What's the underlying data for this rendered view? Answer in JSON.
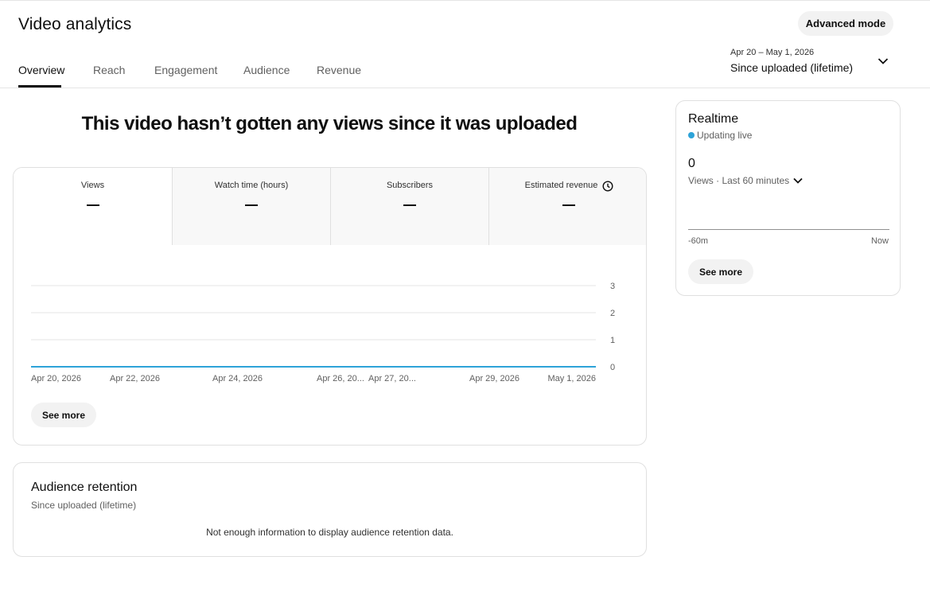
{
  "header": {
    "title": "Video analytics",
    "advanced_mode_label": "Advanced mode",
    "tabs": [
      {
        "label": "Overview",
        "active": true
      },
      {
        "label": "Reach",
        "active": false
      },
      {
        "label": "Engagement",
        "active": false
      },
      {
        "label": "Audience",
        "active": false
      },
      {
        "label": "Revenue",
        "active": false
      }
    ],
    "date_picker": {
      "range": "Apr 20 – May 1, 2026",
      "label": "Since uploaded (lifetime)",
      "icon": "chevron-down-icon"
    }
  },
  "headline": "This video hasn’t gotten any views since it was uploaded",
  "metrics": [
    {
      "label": "Views",
      "value": "—",
      "selected": true
    },
    {
      "label": "Watch time (hours)",
      "value": "—",
      "selected": false
    },
    {
      "label": "Subscribers",
      "value": "—",
      "selected": false
    },
    {
      "label": "Estimated revenue",
      "value": "—",
      "selected": false,
      "icon": "clock-icon"
    }
  ],
  "chart_data": {
    "type": "line",
    "title": "",
    "xlabel": "",
    "ylabel": "",
    "y_axis_position": "right",
    "yticks": [
      0,
      1,
      2,
      3
    ],
    "ylim": [
      0,
      3
    ],
    "grid": true,
    "x_tick_labels": [
      "Apr 20, 2026",
      "Apr 22, 2026",
      "Apr 24, 2026",
      "Apr 26, 20...",
      "Apr 27, 20...",
      "Apr 29, 2026",
      "May 1, 2026"
    ],
    "x": [
      "2026-04-20",
      "2026-04-21",
      "2026-04-22",
      "2026-04-23",
      "2026-04-24",
      "2026-04-25",
      "2026-04-26",
      "2026-04-27",
      "2026-04-28",
      "2026-04-29",
      "2026-04-30",
      "2026-05-01"
    ],
    "series": [
      {
        "values": [
          0,
          0,
          0,
          0,
          0,
          0,
          0,
          0,
          0,
          0,
          0,
          0
        ],
        "color": "#2da3d8"
      }
    ]
  },
  "chart_see_more_label": "See more",
  "retention": {
    "title": "Audience retention",
    "subtitle": "Since uploaded (lifetime)",
    "message": "Not enough information to display audience retention data."
  },
  "realtime": {
    "title": "Realtime",
    "status": "Updating live",
    "status_color": "#2da3d8",
    "count": "0",
    "period": "Views · Last 60 minutes",
    "x_start": "-60m",
    "x_end": "Now",
    "see_more_label": "See more"
  }
}
